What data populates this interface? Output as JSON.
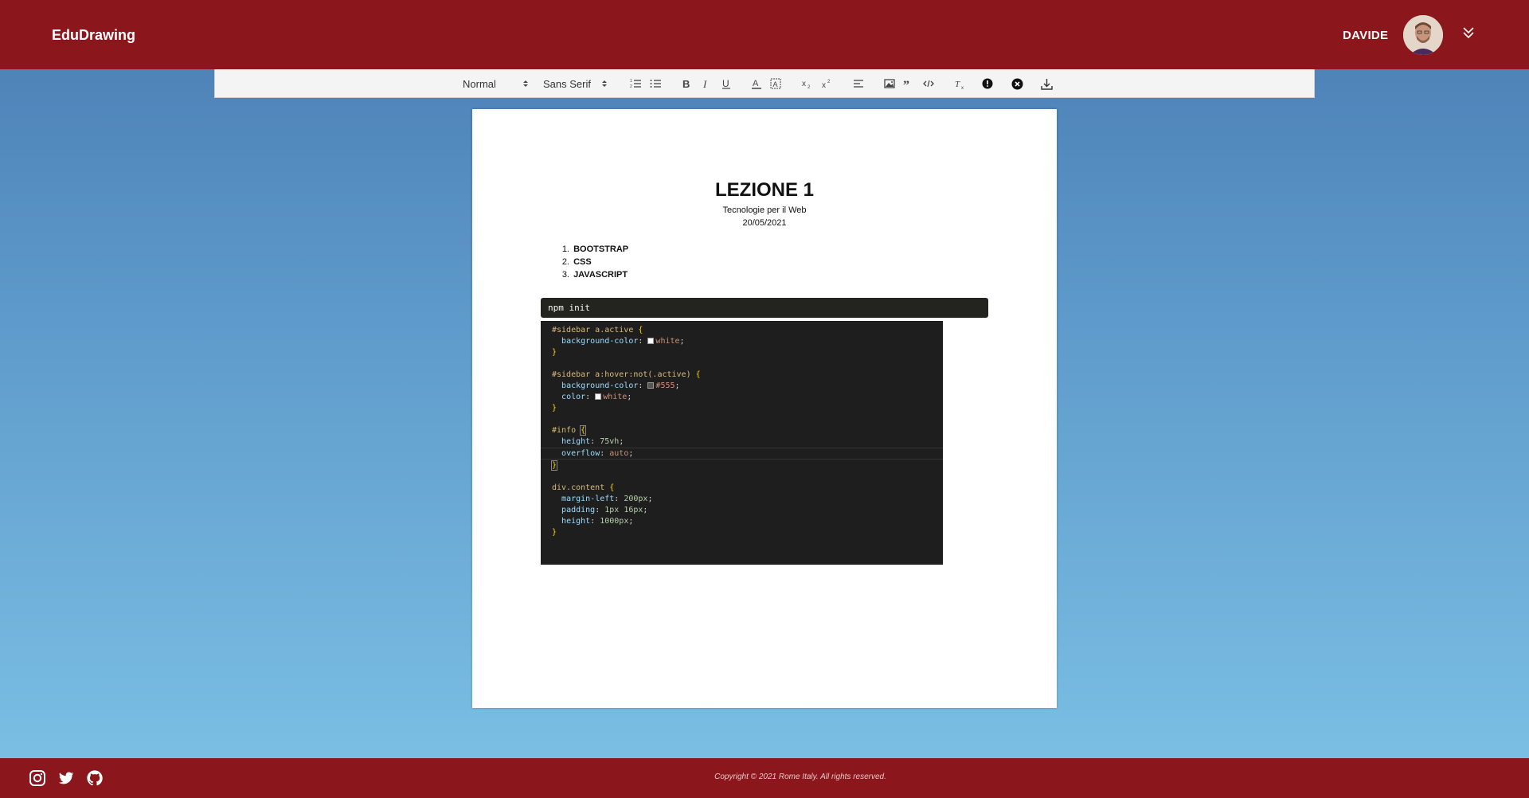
{
  "header": {
    "brand": "EduDrawing",
    "user_name": "DAVIDE"
  },
  "toolbar": {
    "header_picker": "Normal",
    "font_picker": "Sans Serif",
    "buttons": [
      "ordered-list",
      "bullet-list",
      "bold",
      "italic",
      "underline",
      "font-color",
      "background-color",
      "subscript",
      "superscript",
      "align",
      "image",
      "blockquote",
      "code-block",
      "clean-formatting",
      "info",
      "close",
      "download"
    ]
  },
  "document": {
    "title": "LEZIONE 1",
    "subtitle": "Tecnologie per il Web",
    "date": "20/05/2021",
    "list": [
      {
        "num": "1.",
        "text": "BOOTSTRAP"
      },
      {
        "num": "2.",
        "text": "CSS"
      },
      {
        "num": "3.",
        "text": "JAVASCRIPT"
      }
    ],
    "code_block": "npm init",
    "code_image": {
      "l1_sel": "#sidebar a.active ",
      "l2_prop": "background-color",
      "l2_val": "white",
      "l5_sel": "#sidebar a:hover:not(.active) ",
      "l6_prop": "background-color",
      "l6_val": "#555",
      "l7_prop": "color",
      "l7_val": "white",
      "l10_sel": "#info ",
      "l11_prop": "height",
      "l11_val": "75vh",
      "l12_prop": "overflow",
      "l12_val": "auto",
      "l15_sel": "div.content ",
      "l16_prop": "margin-left",
      "l16_val": "200px",
      "l17_prop": "padding",
      "l17_val": "1px 16px",
      "l18_prop": "height",
      "l18_val": "1000px",
      "open_brace": "{",
      "close_brace": "}",
      "colon": ": ",
      "semi": ";"
    }
  },
  "footer": {
    "copyright": "Copyright © 2021 Rome Italy. All rights reserved.",
    "social_icons": [
      "instagram-icon",
      "twitter-icon",
      "github-icon"
    ]
  },
  "colors": {
    "brand_red": "#8b161b",
    "background_top": "#4a7db3",
    "background_bottom": "#7dc2e6"
  }
}
